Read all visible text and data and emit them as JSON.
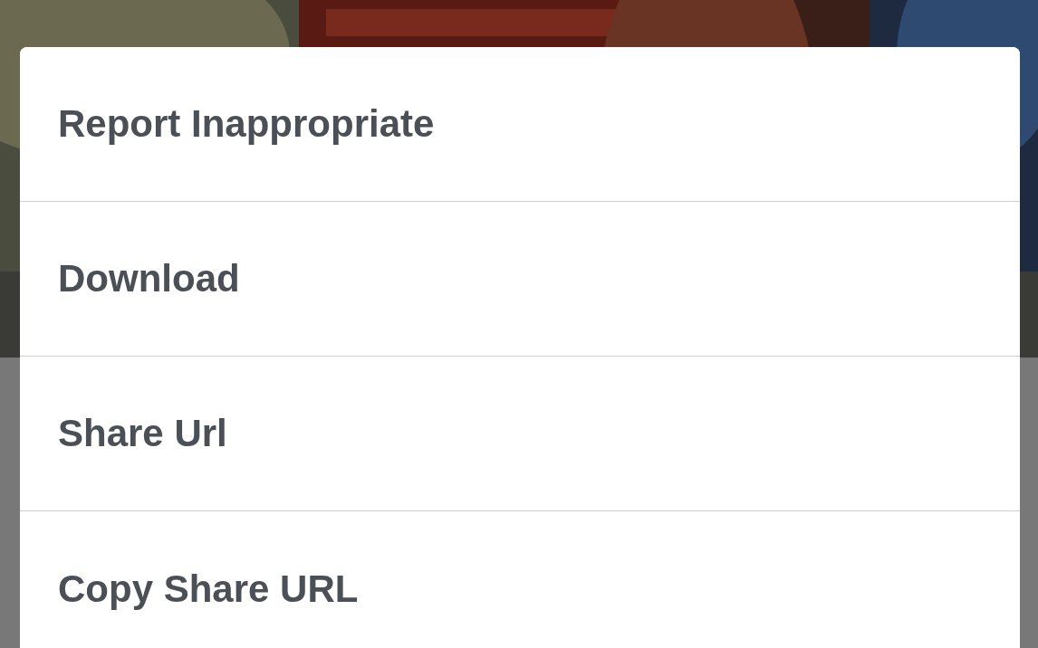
{
  "menu": {
    "items": [
      {
        "label": "Report Inappropriate"
      },
      {
        "label": "Download"
      },
      {
        "label": "Share Url"
      },
      {
        "label": "Copy Share URL"
      }
    ]
  }
}
